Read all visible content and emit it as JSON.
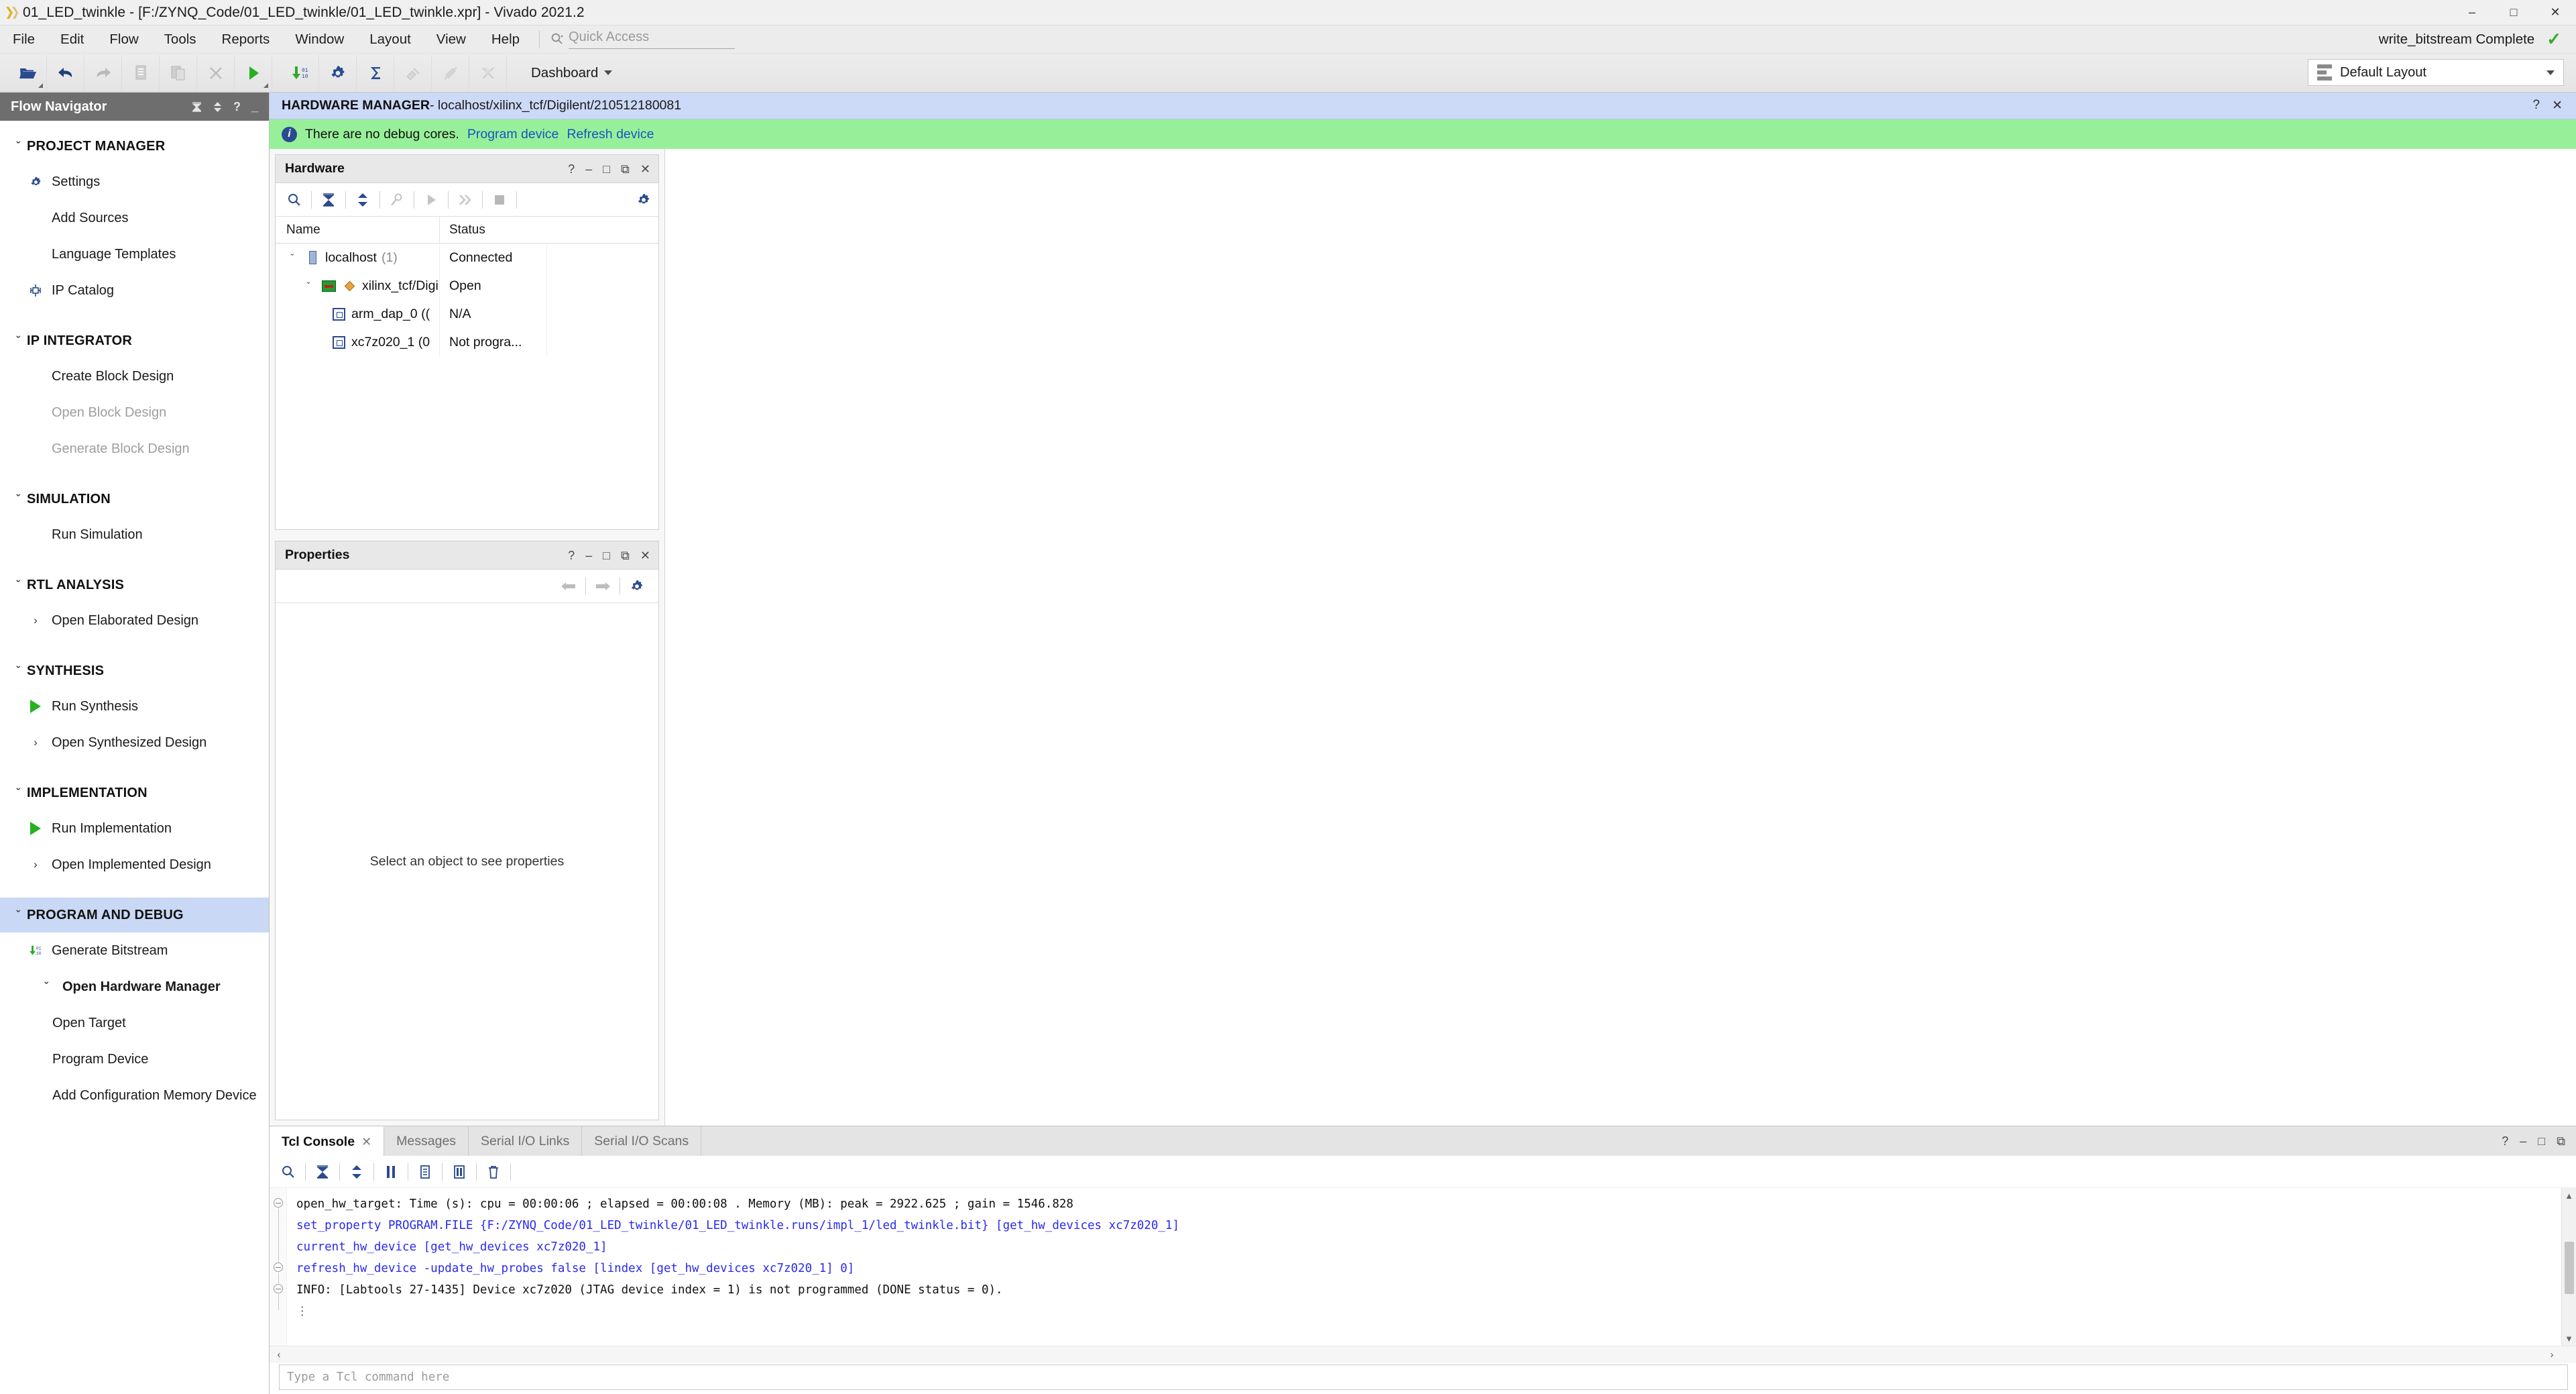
{
  "window": {
    "title": "01_LED_twinkle - [F:/ZYNQ_Code/01_LED_twinkle/01_LED_twinkle.xpr] - Vivado 2021.2",
    "minimize": "–",
    "maximize": "□",
    "close": "✕"
  },
  "menubar": {
    "items": [
      "File",
      "Edit",
      "Flow",
      "Tools",
      "Reports",
      "Window",
      "Layout",
      "View",
      "Help"
    ],
    "quick_access_placeholder": "Quick Access",
    "quick_access_value": "",
    "status_text": "write_bitstream Complete",
    "status_check": "✓"
  },
  "toolbar": {
    "buttons": [
      {
        "name": "open-project-icon",
        "label": "Open Project"
      },
      {
        "name": "undo-icon",
        "label": "Undo"
      },
      {
        "name": "redo-icon",
        "label": "Redo"
      },
      {
        "name": "copy-icon",
        "label": "Copy"
      },
      {
        "name": "paste-icon",
        "label": "Paste"
      },
      {
        "name": "close-x-icon",
        "label": "Close"
      },
      {
        "name": "run-icon",
        "label": "Run"
      },
      {
        "name": "generate-bitstream-icon",
        "label": "Generate Bitstream"
      },
      {
        "name": "settings-gear-icon",
        "label": "Settings"
      },
      {
        "name": "report-sigma-icon",
        "label": "Report"
      },
      {
        "name": "marker-a-icon",
        "label": "Marker A"
      },
      {
        "name": "marker-b-icon",
        "label": "Marker B"
      },
      {
        "name": "marker-c-icon",
        "label": "Marker C"
      }
    ],
    "dashboard_label": "Dashboard",
    "layout_label": "Default Layout"
  },
  "flow_navigator": {
    "title": "Flow Navigator",
    "header_tools": [
      "collapse-all",
      "expand-all",
      "help",
      "minimize"
    ],
    "sections": [
      {
        "label": "PROJECT MANAGER",
        "chevron": "ˇ",
        "active": false,
        "items": [
          {
            "label": "Settings",
            "icon": "gear-icon",
            "disabled": false,
            "expandable": false,
            "bold": false
          },
          {
            "label": "Add Sources",
            "icon": "",
            "disabled": false,
            "expandable": false,
            "bold": false
          },
          {
            "label": "Language Templates",
            "icon": "",
            "disabled": false,
            "expandable": false,
            "bold": false
          },
          {
            "label": "IP Catalog",
            "icon": "ip-catalog-icon",
            "disabled": false,
            "expandable": false,
            "bold": false
          }
        ]
      },
      {
        "label": "IP INTEGRATOR",
        "chevron": "ˇ",
        "active": false,
        "items": [
          {
            "label": "Create Block Design",
            "icon": "",
            "disabled": false,
            "expandable": false,
            "bold": false
          },
          {
            "label": "Open Block Design",
            "icon": "",
            "disabled": true,
            "expandable": false,
            "bold": false
          },
          {
            "label": "Generate Block Design",
            "icon": "",
            "disabled": true,
            "expandable": false,
            "bold": false
          }
        ]
      },
      {
        "label": "SIMULATION",
        "chevron": "ˇ",
        "active": false,
        "items": [
          {
            "label": "Run Simulation",
            "icon": "",
            "disabled": false,
            "expandable": false,
            "bold": false
          }
        ]
      },
      {
        "label": "RTL ANALYSIS",
        "chevron": "ˇ",
        "active": false,
        "items": [
          {
            "label": "Open Elaborated Design",
            "icon": "",
            "disabled": false,
            "expandable": true,
            "bold": false
          }
        ]
      },
      {
        "label": "SYNTHESIS",
        "chevron": "ˇ",
        "active": false,
        "items": [
          {
            "label": "Run Synthesis",
            "icon": "play-green-icon",
            "disabled": false,
            "expandable": false,
            "bold": false
          },
          {
            "label": "Open Synthesized Design",
            "icon": "",
            "disabled": false,
            "expandable": true,
            "bold": false
          }
        ]
      },
      {
        "label": "IMPLEMENTATION",
        "chevron": "ˇ",
        "active": false,
        "items": [
          {
            "label": "Run Implementation",
            "icon": "play-green-icon",
            "disabled": false,
            "expandable": false,
            "bold": false
          },
          {
            "label": "Open Implemented Design",
            "icon": "",
            "disabled": false,
            "expandable": true,
            "bold": false
          }
        ]
      },
      {
        "label": "PROGRAM AND DEBUG",
        "chevron": "ˇ",
        "active": true,
        "items": [
          {
            "label": "Generate Bitstream",
            "icon": "generate-bitstream-icon",
            "disabled": false,
            "expandable": false,
            "bold": false
          },
          {
            "label": "Open Hardware Manager",
            "icon": "",
            "disabled": false,
            "expandable": true,
            "bold": true,
            "expanded": true
          },
          {
            "label": "Open Target",
            "icon": "",
            "disabled": false,
            "expandable": false,
            "bold": false,
            "sub": true
          },
          {
            "label": "Program Device",
            "icon": "",
            "disabled": false,
            "expandable": false,
            "bold": false,
            "sub": true
          },
          {
            "label": "Add Configuration Memory Device",
            "icon": "",
            "disabled": false,
            "expandable": false,
            "bold": false,
            "sub": true
          }
        ]
      }
    ]
  },
  "hardware_manager": {
    "title": "HARDWARE MANAGER",
    "subtitle": " - localhost/xilinx_tcf/Digilent/210512180081",
    "help": "?",
    "close": "✕",
    "notice": {
      "icon": "info-icon",
      "text": "There are no debug cores.",
      "links": [
        "Program device",
        "Refresh device"
      ]
    }
  },
  "hardware_panel": {
    "title": "Hardware",
    "head_buttons": [
      "?",
      "–",
      "□",
      "⧉",
      "✕"
    ],
    "toolbar_icons": [
      "search-icon",
      "collapse-all-icon",
      "expand-all-icon",
      "auto-connect-icon",
      "run-trigger-icon",
      "run-trigger-immediate-icon",
      "stop-icon",
      "gear-icon"
    ],
    "columns": [
      "Name",
      "Status"
    ],
    "rows": [
      {
        "name": "localhost",
        "count": "(1)",
        "status": "Connected",
        "icon": "host-icon",
        "chevron": "ˇ",
        "indent": 0
      },
      {
        "name": "xilinx_tcf/Digile",
        "count": "",
        "status": "Open",
        "icon": "board-icon",
        "chevron": "ˇ",
        "indent": 1
      },
      {
        "name": "arm_dap_0 ((",
        "count": "",
        "status": "N/A",
        "icon": "chip-icon",
        "chevron": "",
        "indent": 2
      },
      {
        "name": "xc7z020_1 (0",
        "count": "",
        "status": "Not progra...",
        "icon": "chip-icon",
        "chevron": "",
        "indent": 2
      }
    ]
  },
  "properties_panel": {
    "title": "Properties",
    "head_buttons": [
      "?",
      "–",
      "□",
      "⧉",
      "✕"
    ],
    "toolbar_icons": [
      "back-arrow-icon",
      "forward-arrow-icon",
      "gear-icon"
    ],
    "empty_message": "Select an object to see properties"
  },
  "console": {
    "tabs": [
      {
        "label": "Tcl Console",
        "active": true,
        "closable": true
      },
      {
        "label": "Messages",
        "active": false,
        "closable": false
      },
      {
        "label": "Serial I/O Links",
        "active": false,
        "closable": false
      },
      {
        "label": "Serial I/O Scans",
        "active": false,
        "closable": false
      }
    ],
    "close_symbol": "✕",
    "head_buttons": [
      "?",
      "–",
      "□",
      "⧉"
    ],
    "toolbar_icons": [
      "search-icon",
      "collapse-all-icon",
      "expand-all-icon",
      "pause-icon",
      "copy-icon",
      "report-icon",
      "trash-icon"
    ],
    "lines": [
      {
        "text": "open_hw_target: Time (s): cpu = 00:00:06 ; elapsed = 00:00:08 . Memory (MB): peak = 2922.625 ; gain = 1546.828",
        "color": "black",
        "marker": "collapse"
      },
      {
        "text": "set_property PROGRAM.FILE {F:/ZYNQ_Code/01_LED_twinkle/01_LED_twinkle.runs/impl_1/led_twinkle.bit} [get_hw_devices xc7z020_1]",
        "color": "blue",
        "marker": "none"
      },
      {
        "text": "current_hw_device [get_hw_devices xc7z020_1]",
        "color": "blue",
        "marker": "none"
      },
      {
        "text": "refresh_hw_device -update_hw_probes false [lindex [get_hw_devices xc7z020_1] 0]",
        "color": "blue",
        "marker": "collapse"
      },
      {
        "text": "INFO: [Labtools 27-1435] Device xc7z020 (JTAG device index = 1) is not programmed (DONE status = 0).",
        "color": "black",
        "marker": "collapse"
      },
      {
        "text": "⋮",
        "color": "dots",
        "marker": "none"
      }
    ],
    "command_placeholder": "Type a Tcl command here",
    "command_value": "",
    "scroll_left_arrow": "‹",
    "scroll_right_arrow": "›",
    "scroll_up_arrow": "▲",
    "scroll_down_arrow": "▼"
  }
}
